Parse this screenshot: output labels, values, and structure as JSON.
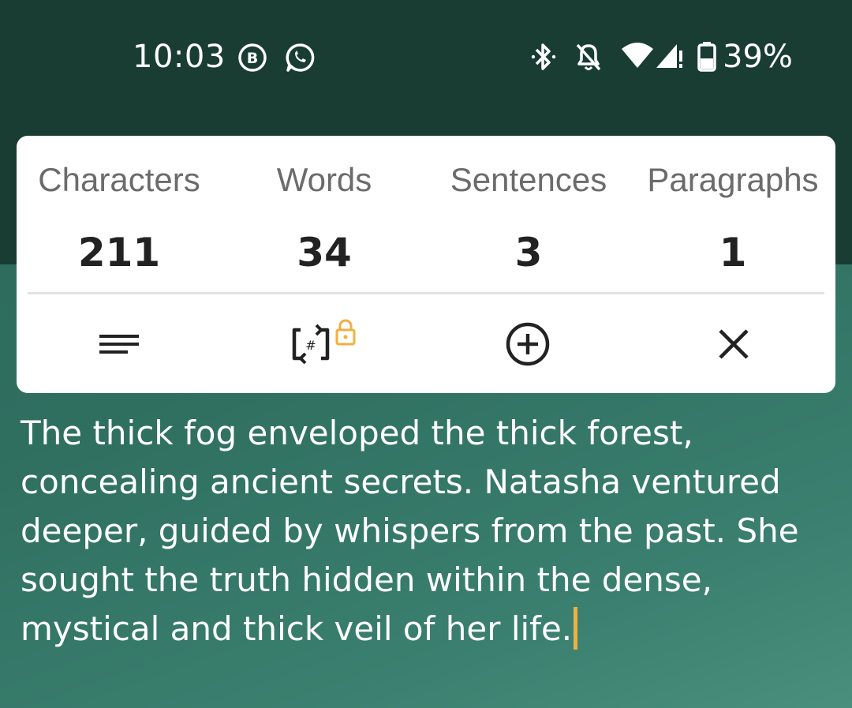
{
  "status_bar": {
    "time": "10:03",
    "notification_icons": [
      "b-circle-icon",
      "whatsapp-icon"
    ],
    "system_icons": [
      "bluetooth-icon",
      "bell-off-icon",
      "wifi-icon",
      "signal-icon",
      "battery-icon"
    ],
    "battery": "39%"
  },
  "stats": {
    "characters": {
      "label": "Characters",
      "value": "211"
    },
    "words": {
      "label": "Words",
      "value": "34"
    },
    "sentences": {
      "label": "Sentences",
      "value": "3"
    },
    "paragraphs": {
      "label": "Paragraphs",
      "value": "1"
    }
  },
  "toolbar": {
    "icons": [
      "menu-lines-icon",
      "hash-refresh-icon",
      "add-circle-icon",
      "close-icon"
    ],
    "lock_badge_color": "#f0b040"
  },
  "text": {
    "content": "The thick fog enveloped the thick forest, concealing ancient secrets. Natasha ventured deeper, guided by whispers from the past. She sought the truth hidden within the dense, mystical and thick veil of her life."
  },
  "colors": {
    "top_band": "#193d32",
    "background": "#2f6f60",
    "caret": "#f0b040"
  }
}
